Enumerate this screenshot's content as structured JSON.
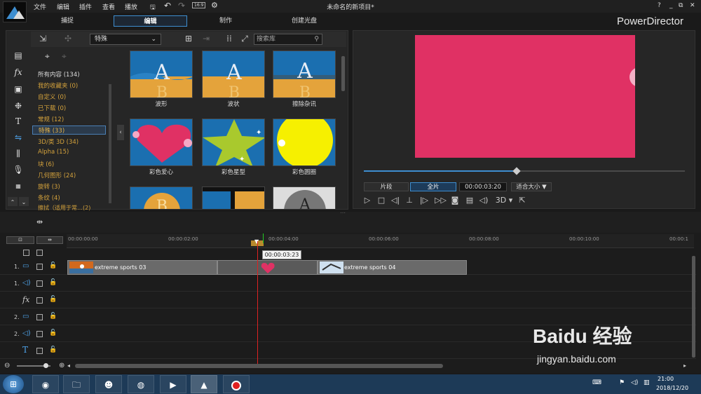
{
  "menu": [
    "文件",
    "编辑",
    "插件",
    "查看",
    "播放"
  ],
  "window_title": "未命名的新项目*",
  "win_controls": [
    "?",
    "_",
    "⧉",
    "✕"
  ],
  "tabs": [
    "捕捉",
    "编辑",
    "制作",
    "创建光盘"
  ],
  "brand": "PowerDirector",
  "library": {
    "dropdown": "特殊",
    "search_placeholder": "搜索库",
    "categories": [
      "所有内容 (134)",
      "我的收藏夹 (0)",
      "自定义 (0)",
      "已下载 (0)",
      "常规 (12)",
      "特殊 (33)",
      "3D/类 3D (34)",
      "Alpha (15)",
      "块 (6)",
      "几何图形 (24)",
      "旋转 (3)",
      "条纹 (4)",
      "擦拭（适用于常…(2)"
    ],
    "thumbs": [
      "波形",
      "波状",
      "擦除杂讯",
      "彩色爱心",
      "彩色星型",
      "彩色圆圈",
      "",
      "",
      ""
    ]
  },
  "preview": {
    "mode_clip": "片段",
    "mode_full": "全片",
    "timecode": "00:00:03:20",
    "fit": "适合大小 ▼",
    "progress": 0.476,
    "label_3d": "3D"
  },
  "timeline": {
    "ticks": [
      "00:00:00:00",
      "00:00:02:00",
      "00:00:04:00",
      "00:00:06:00",
      "00:00:08:00",
      "00:00:10:00",
      "00:00:1"
    ],
    "tooltip": "00:00:03:23",
    "tracks": [
      "1.",
      "1.",
      "",
      "2.",
      "2.",
      "",
      ""
    ],
    "clip1": "extreme sports 03",
    "clip2": "extreme sports 04"
  },
  "taskbar": {
    "time": "21:00",
    "date": "2018/12/20"
  },
  "watermark": {
    "brand": "Baidu 经验",
    "url": "jingyan.baidu.com"
  }
}
